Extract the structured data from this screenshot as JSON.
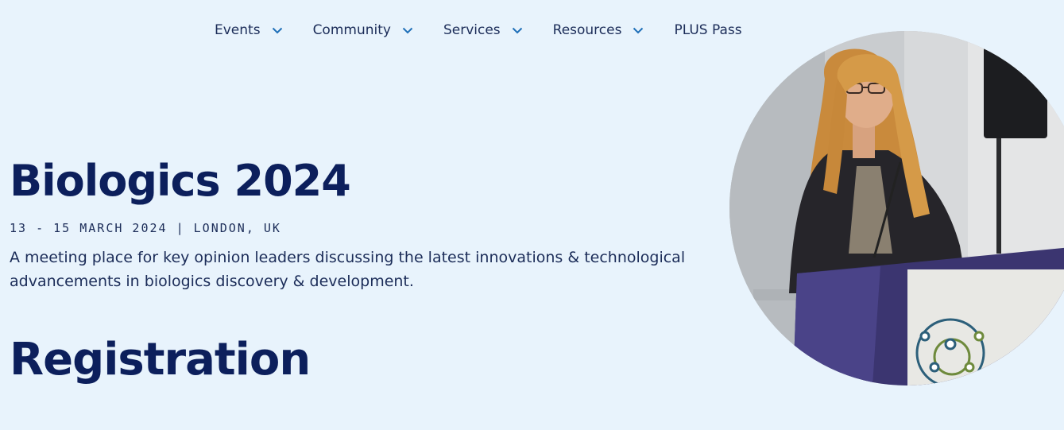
{
  "nav": {
    "items": [
      {
        "label": "Events",
        "has_dropdown": true
      },
      {
        "label": "Community",
        "has_dropdown": true
      },
      {
        "label": "Services",
        "has_dropdown": true
      },
      {
        "label": "Resources",
        "has_dropdown": true
      },
      {
        "label": "PLUS Pass",
        "has_dropdown": false
      }
    ]
  },
  "hero": {
    "title": "Biologics 2024",
    "meta": "13 - 15 MARCH 2024 | LONDON, UK",
    "description": "A meeting place for key opinion leaders discussing the latest innovations & technological advancements in biologics discovery & development."
  },
  "section": {
    "title": "Registration"
  },
  "icons": {
    "nav_dropdown": "chevron-down-icon"
  },
  "colors": {
    "background": "#e8f3fc",
    "heading": "#0c1f5c",
    "text": "#1b2c58",
    "chevron": "#1e6fb8"
  }
}
